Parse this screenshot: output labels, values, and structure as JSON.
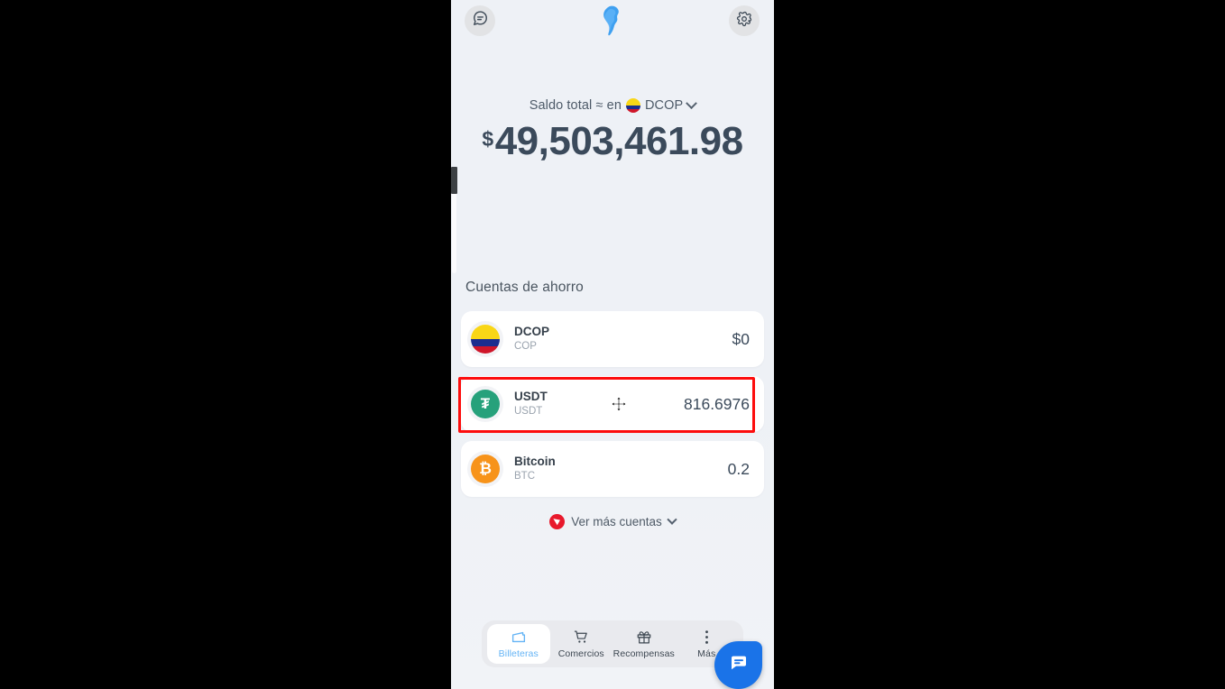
{
  "app": {
    "logo_icon": "south-america-map-icon",
    "chat_icon": "chat-bubble-icon",
    "settings_icon": "gear-icon"
  },
  "balance": {
    "label": "Saldo total ≈ en",
    "currency_code": "DCOP",
    "currency_flag_icon": "colombia-flag-icon",
    "dropdown_icon": "chevron-down-icon",
    "currency_symbol": "$",
    "amount": "49,503,461.98"
  },
  "accounts_section": {
    "title": "Cuentas de ahorro",
    "items": [
      {
        "name": "DCOP",
        "ticker": "COP",
        "value": "$0",
        "icon": "colombia-flag-icon",
        "icon_glyph": "",
        "highlighted": false
      },
      {
        "name": "USDT",
        "ticker": "USDT",
        "value": "816.6976",
        "icon": "tether-icon",
        "icon_glyph": "₮",
        "highlighted": true
      },
      {
        "name": "Bitcoin",
        "ticker": "BTC",
        "value": "0.2",
        "icon": "bitcoin-icon",
        "icon_glyph": "₿",
        "highlighted": false
      }
    ],
    "show_more_label": "Ver más cuentas",
    "show_more_icon": "tron-icon",
    "show_more_chevron": "chevron-down-icon"
  },
  "bottom_nav": {
    "items": [
      {
        "label": "Billeteras",
        "icon": "wallet-icon",
        "active": true
      },
      {
        "label": "Comercios",
        "icon": "cart-icon",
        "active": false
      },
      {
        "label": "Recompensas",
        "icon": "gift-icon",
        "active": false
      },
      {
        "label": "Más",
        "icon": "more-dots-icon",
        "active": false
      }
    ]
  },
  "fab": {
    "icon": "chat-bubble-icon"
  },
  "annotation": {
    "highlight_color": "#fd0d0d",
    "cursor_icon": "move-cursor-icon"
  },
  "theme": {
    "accent_blue": "#1a73e8",
    "text_dark": "#3b4a5b",
    "text_muted": "#9aa3ae",
    "tether_green": "#26a17b",
    "bitcoin_orange": "#f7931a",
    "tron_red": "#e8192c"
  }
}
